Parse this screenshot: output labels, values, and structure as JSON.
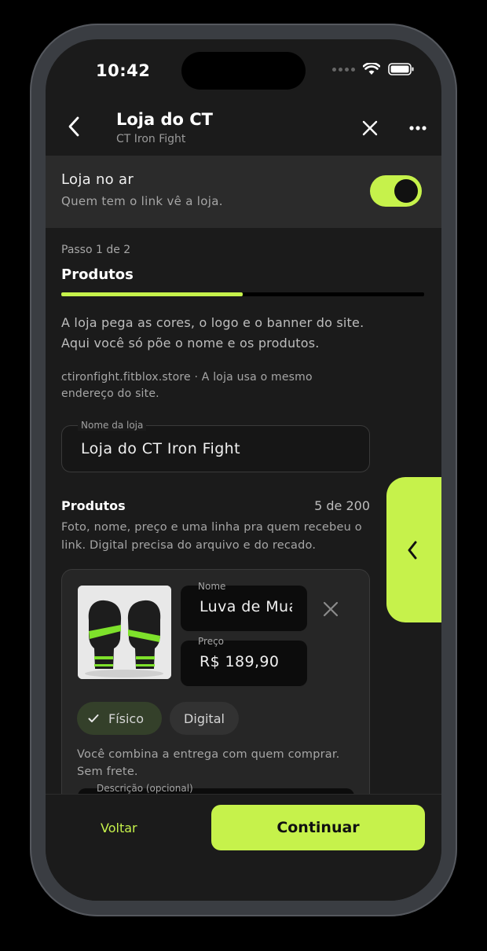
{
  "status_bar": {
    "time": "10:42"
  },
  "header": {
    "title": "Loja do CT",
    "subtitle": "CT Iron Fight"
  },
  "live": {
    "title": "Loja no ar",
    "subtitle": "Quem tem o link vê a loja.",
    "enabled": true
  },
  "step": {
    "label": "Passo 1 de 2",
    "title": "Produtos",
    "progress": 0.5
  },
  "intro": "A loja pega as cores, o logo e o banner do site. Aqui você só põe o nome e os produtos.",
  "domain_note": "ctironfight.fitblox.store · A loja usa o mesmo endereço do site.",
  "store_name": {
    "label": "Nome da loja",
    "value": "Loja do CT Iron Fight"
  },
  "products": {
    "title": "Produtos",
    "count": "5 de 200",
    "description": "Foto, nome, preço e uma linha pra quem recebeu o link. Digital precisa do arquivo e do recado.",
    "items": [
      {
        "name_label": "Nome",
        "name_value": "Luva de Muay Thai",
        "price_label": "Preço",
        "price_value": "R$ 189,90",
        "type_options": [
          "Físico",
          "Digital"
        ],
        "selected_type": "Físico",
        "delivery_note": "Você combina a entrega com quem comprar. Sem frete.",
        "description_label": "Descrição (opcional)"
      }
    ]
  },
  "footer": {
    "back_label": "Voltar",
    "continue_label": "Continuar"
  },
  "colors": {
    "accent": "#c6f24b",
    "background": "#1b1b1b",
    "card": "#262626"
  }
}
